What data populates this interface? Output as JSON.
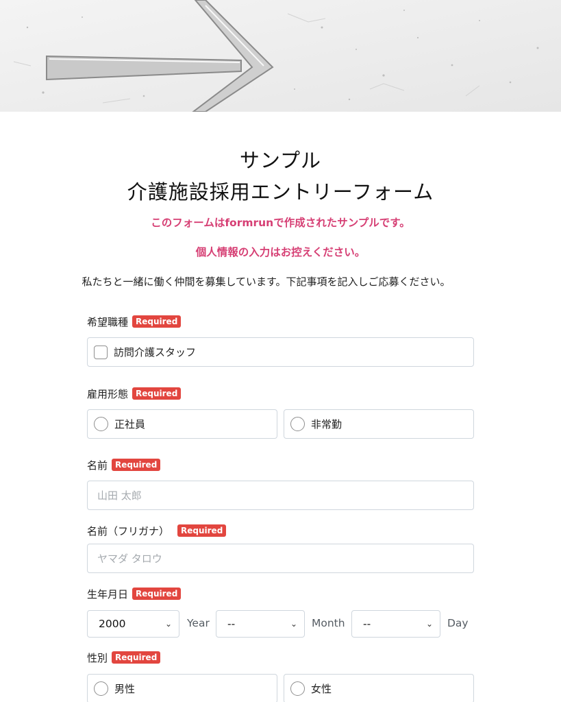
{
  "header": {
    "title_line1": "サンプル",
    "title_line2": "介護施設採用エントリーフォーム",
    "notice1": "このフォームはformrunで作成されたサンプルです。",
    "notice2": "個人情報の入力はお控えください。",
    "intro": "私たちと一緒に働く仲間を募集しています。下記事項を記入しご応募ください。"
  },
  "required_badge": "Required",
  "fields": {
    "job_type": {
      "label": "希望職種",
      "options": [
        "訪問介護スタッフ"
      ]
    },
    "employment": {
      "label": "雇用形態",
      "options": [
        "正社員",
        "非常勤"
      ]
    },
    "name": {
      "label": "名前",
      "placeholder": "山田 太郎"
    },
    "name_kana": {
      "label": "名前（フリガナ）",
      "placeholder": "ヤマダ タロウ"
    },
    "birthdate": {
      "label": "生年月日",
      "year_value": "2000",
      "year_unit": "Year",
      "month_value": "--",
      "month_unit": "Month",
      "day_value": "--",
      "day_unit": "Day"
    },
    "gender": {
      "label": "性別",
      "options": [
        "男性",
        "女性"
      ]
    }
  },
  "icons": {
    "select_arrow": "chevron-down-icon"
  },
  "colors": {
    "notice": "#d63f74",
    "required": "#e2463f",
    "border": "#cfd6dd"
  }
}
